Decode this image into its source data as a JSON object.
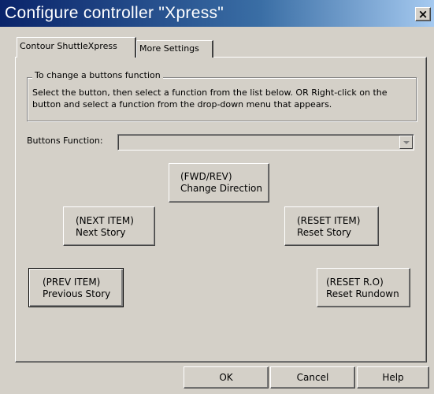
{
  "window": {
    "title": "Configure controller \"Xpress\"",
    "close_glyph": "×"
  },
  "tabs": [
    {
      "label": "Contour ShuttleXpress",
      "active": true
    },
    {
      "label": "More Settings",
      "active": false
    }
  ],
  "group": {
    "legend": "To change a buttons function",
    "instructions": "Select the button, then select a function from the list below. OR Right-click on the button and select a function from the drop-down menu that appears."
  },
  "buttons_function": {
    "label": "Buttons Function:",
    "value": ""
  },
  "controller_buttons": {
    "fwd_rev": {
      "code": "(FWD/REV)",
      "desc": "Change Direction"
    },
    "next_item": {
      "code": "(NEXT ITEM)",
      "desc": "Next Story"
    },
    "reset_item": {
      "code": "(RESET ITEM)",
      "desc": "Reset Story"
    },
    "prev_item": {
      "code": "(PREV ITEM)",
      "desc": "Previous Story"
    },
    "reset_ro": {
      "code": "(RESET R.O)",
      "desc": "Reset Rundown"
    }
  },
  "dialog_buttons": {
    "ok": "OK",
    "cancel": "Cancel",
    "help": "Help"
  }
}
